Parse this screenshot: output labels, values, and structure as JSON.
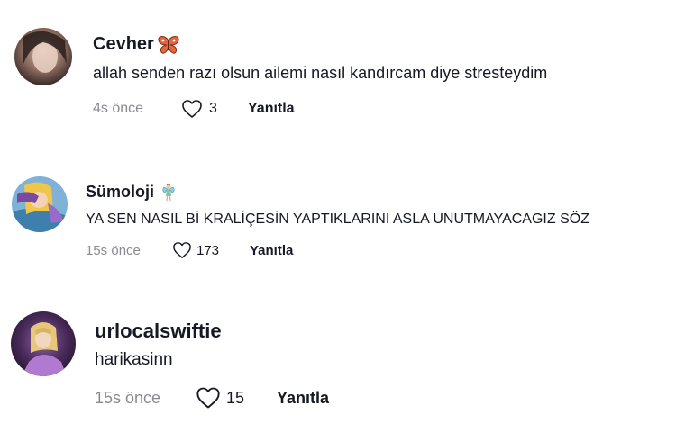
{
  "comments": [
    {
      "username": "Cevher",
      "emoji_icon": "butterfly-icon",
      "text": "allah senden razı olsun ailemi nasıl kandırcam diye stresteydim",
      "time": "4s önce",
      "likes": "3",
      "reply_label": "Yanıtla"
    },
    {
      "username": "Sümoloji",
      "emoji_icon": "fairy-icon",
      "text": "YA SEN NASIL Bİ KRALİÇESİN YAPTIKLARINI ASLA UNUTMAYACAGIZ SÖZ",
      "time": "15s önce",
      "likes": "173",
      "reply_label": "Yanıtla"
    },
    {
      "username": "urlocalswiftie",
      "text": "harikasinn",
      "time": "15s önce",
      "likes": "15",
      "reply_label": "Yanıtla"
    }
  ],
  "colors": {
    "text": "#161823",
    "muted": "#8a8b91",
    "butterfly": "#e8643c"
  }
}
